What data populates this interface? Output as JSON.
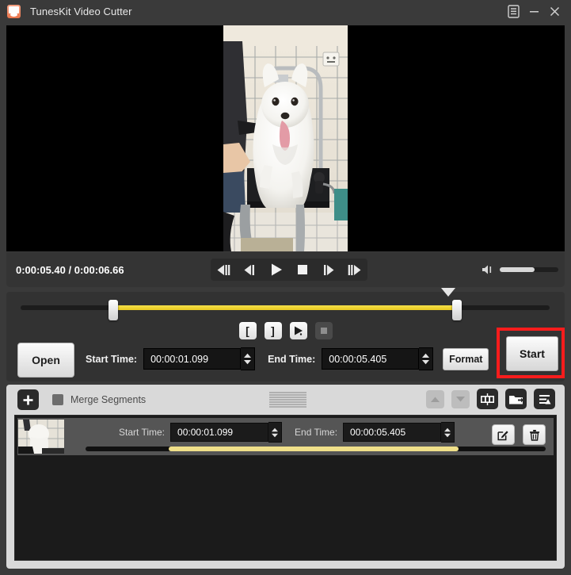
{
  "window": {
    "title": "TunesKit Video Cutter",
    "logo_icon": "app-logo-icon",
    "menu_icon": "menu-icon",
    "minimize_icon": "minimize-icon",
    "close_icon": "close-icon"
  },
  "player": {
    "current_time": "0:00:05.40",
    "total_time": "0:00:06.66",
    "time_readout": "0:00:05.40 / 0:00:06.66",
    "volume_percent": 60,
    "volume_icon": "volume-icon",
    "controls": [
      {
        "name": "step-back-fast-button",
        "icon": "prev-frames-icon"
      },
      {
        "name": "step-back-button",
        "icon": "prev-frame-icon"
      },
      {
        "name": "play-button",
        "icon": "play-icon"
      },
      {
        "name": "stop-button",
        "icon": "stop-icon"
      },
      {
        "name": "step-forward-button",
        "icon": "next-frame-icon"
      },
      {
        "name": "step-forward-fast-button",
        "icon": "next-frames-icon"
      }
    ]
  },
  "timeline": {
    "start_percent": 17.5,
    "end_percent": 82.5,
    "playhead_percent": 80.8,
    "range_color": "#e8c81f"
  },
  "trim": {
    "mark_in_label": "[",
    "mark_out_label": "]",
    "preview_icon": "preview-play-icon",
    "stop_icon": "stop-square-icon",
    "open_label": "Open",
    "start_time_label": "Start Time:",
    "start_time_value": "00:00:01.099",
    "end_time_label": "End Time:",
    "end_time_value": "00:00:05.405",
    "format_label": "Format",
    "start_label": "Start",
    "highlight_color": "#f81c1c"
  },
  "segments": {
    "add_icon": "plus-icon",
    "merge_label": "Merge Segments",
    "merge_checked": false,
    "grip_icon": "drag-grip-icon",
    "move_up_icon": "chevron-up-icon",
    "move_down_icon": "chevron-down-icon",
    "tool_icons": [
      "film-strip-icon",
      "export-folder-icon",
      "list-settings-icon"
    ],
    "rows": [
      {
        "thumbnail": "segment-thumbnail",
        "start_time_label": "Start Time:",
        "start_time_value": "00:00:01.099",
        "end_time_label": "End Time:",
        "end_time_value": "00:00:05.405",
        "edit_icon": "edit-icon",
        "delete_icon": "trash-icon",
        "range_start_percent": 18,
        "range_end_percent": 81
      }
    ]
  }
}
